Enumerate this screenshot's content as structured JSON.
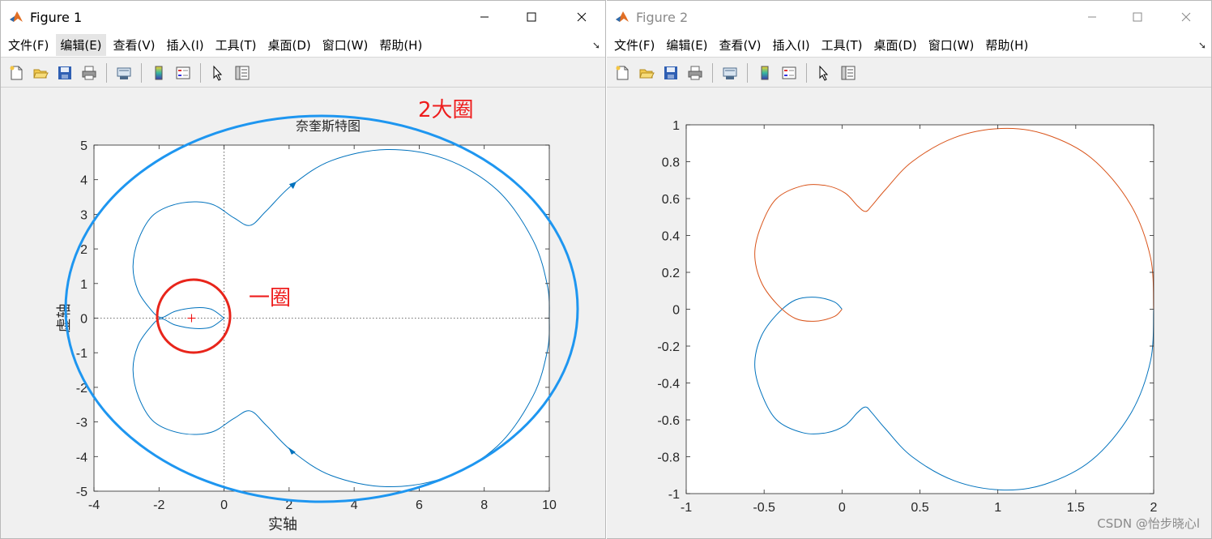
{
  "menu_labels": [
    "文件(F)",
    "编辑(E)",
    "查看(V)",
    "插入(I)",
    "工具(T)",
    "桌面(D)",
    "窗口(W)",
    "帮助(H)"
  ],
  "toolbar_icons": [
    "new-figure-icon",
    "open-icon",
    "save-icon",
    "print-icon",
    "link-plot-icon",
    "insert-colorbar-icon",
    "insert-legend-icon",
    "edit-plot-icon",
    "property-inspector-icon"
  ],
  "figure1": {
    "title": "Figure 1",
    "active_menu_index": 1,
    "annotation_big": "2大圈",
    "annotation_small": "一圈",
    "chart_data": {
      "type": "line",
      "title": "奈奎斯特图",
      "xlabel": "实轴",
      "ylabel": "虚轴",
      "xlim": [
        -4,
        10
      ],
      "ylim": [
        -5,
        5
      ],
      "xticks": [
        -4,
        -2,
        0,
        2,
        4,
        6,
        8,
        10
      ],
      "yticks": [
        -5,
        -4,
        -3,
        -2,
        -1,
        0,
        1,
        2,
        3,
        4,
        5
      ],
      "grid": false,
      "marker_point": [
        -1,
        0
      ],
      "series": [
        {
          "color": "#0072bd",
          "points": [
            [
              0,
              0
            ],
            [
              -0.4,
              0.26
            ],
            [
              -0.9,
              0.3
            ],
            [
              -1.5,
              0.2
            ],
            [
              -1.95,
              0.02
            ],
            [
              -2.3,
              0.3
            ],
            [
              -2.65,
              0.8
            ],
            [
              -2.8,
              1.5
            ],
            [
              -2.62,
              2.3
            ],
            [
              -2.15,
              3.0
            ],
            [
              -1.3,
              3.33
            ],
            [
              -0.4,
              3.3
            ],
            [
              0.3,
              2.9
            ],
            [
              0.8,
              2.68
            ],
            [
              1.3,
              3.1
            ],
            [
              2.1,
              3.85
            ],
            [
              3.3,
              4.55
            ],
            [
              5.0,
              4.87
            ],
            [
              6.8,
              4.6
            ],
            [
              8.4,
              3.7
            ],
            [
              9.5,
              2.25
            ],
            [
              9.95,
              0.9
            ],
            [
              10,
              0
            ]
          ]
        },
        {
          "color": "#0072bd",
          "points": [
            [
              0,
              0
            ],
            [
              -0.4,
              -0.26
            ],
            [
              -0.9,
              -0.3
            ],
            [
              -1.5,
              -0.2
            ],
            [
              -1.95,
              -0.02
            ],
            [
              -2.3,
              -0.3
            ],
            [
              -2.65,
              -0.8
            ],
            [
              -2.8,
              -1.5
            ],
            [
              -2.62,
              -2.3
            ],
            [
              -2.15,
              -3.0
            ],
            [
              -1.3,
              -3.33
            ],
            [
              -0.4,
              -3.3
            ],
            [
              0.3,
              -2.9
            ],
            [
              0.8,
              -2.68
            ],
            [
              1.3,
              -3.1
            ],
            [
              2.1,
              -3.85
            ],
            [
              3.3,
              -4.55
            ],
            [
              5.0,
              -4.87
            ],
            [
              6.8,
              -4.6
            ],
            [
              8.4,
              -3.7
            ],
            [
              9.5,
              -2.25
            ],
            [
              9.95,
              -0.9
            ],
            [
              10,
              0
            ]
          ]
        }
      ],
      "direction_arrows": [
        [
          2.1,
          3.85
        ],
        [
          2.1,
          -3.85
        ]
      ]
    }
  },
  "figure2": {
    "title": "Figure 2",
    "chart_data": {
      "type": "line",
      "xlim": [
        -1,
        2
      ],
      "ylim": [
        -1,
        1
      ],
      "xticks": [
        -1,
        -0.5,
        0,
        0.5,
        1,
        1.5,
        2
      ],
      "yticks": [
        -1,
        -0.8,
        -0.6,
        -0.4,
        -0.2,
        0,
        0.2,
        0.4,
        0.6,
        0.8,
        1
      ],
      "grid": false,
      "series": [
        {
          "color": "#0072bd",
          "points": [
            [
              2,
              0
            ],
            [
              1.98,
              -0.28
            ],
            [
              1.85,
              -0.57
            ],
            [
              1.6,
              -0.82
            ],
            [
              1.3,
              -0.95
            ],
            [
              1.02,
              -0.98
            ],
            [
              0.72,
              -0.93
            ],
            [
              0.45,
              -0.8
            ],
            [
              0.28,
              -0.65
            ],
            [
              0.19,
              -0.56
            ],
            [
              0.15,
              -0.53
            ],
            [
              0.1,
              -0.56
            ],
            [
              0.02,
              -0.63
            ],
            [
              -0.1,
              -0.67
            ],
            [
              -0.25,
              -0.67
            ],
            [
              -0.42,
              -0.6
            ],
            [
              -0.52,
              -0.45
            ],
            [
              -0.56,
              -0.3
            ],
            [
              -0.52,
              -0.15
            ],
            [
              -0.42,
              -0.03
            ],
            [
              -0.3,
              0.05
            ],
            [
              -0.17,
              0.065
            ],
            [
              -0.05,
              0.04
            ],
            [
              0,
              0
            ]
          ]
        },
        {
          "color": "#d95319",
          "points": [
            [
              2,
              0
            ],
            [
              1.98,
              0.28
            ],
            [
              1.85,
              0.57
            ],
            [
              1.6,
              0.82
            ],
            [
              1.3,
              0.95
            ],
            [
              1.02,
              0.98
            ],
            [
              0.72,
              0.93
            ],
            [
              0.45,
              0.8
            ],
            [
              0.28,
              0.65
            ],
            [
              0.19,
              0.56
            ],
            [
              0.15,
              0.53
            ],
            [
              0.1,
              0.56
            ],
            [
              0.02,
              0.63
            ],
            [
              -0.1,
              0.67
            ],
            [
              -0.25,
              0.67
            ],
            [
              -0.42,
              0.6
            ],
            [
              -0.52,
              0.45
            ],
            [
              -0.56,
              0.3
            ],
            [
              -0.52,
              0.15
            ],
            [
              -0.42,
              0.03
            ],
            [
              -0.3,
              -0.05
            ],
            [
              -0.17,
              -0.065
            ],
            [
              -0.05,
              -0.04
            ],
            [
              0,
              0
            ]
          ]
        }
      ]
    }
  },
  "watermark": "CSDN @怡步晓心l"
}
